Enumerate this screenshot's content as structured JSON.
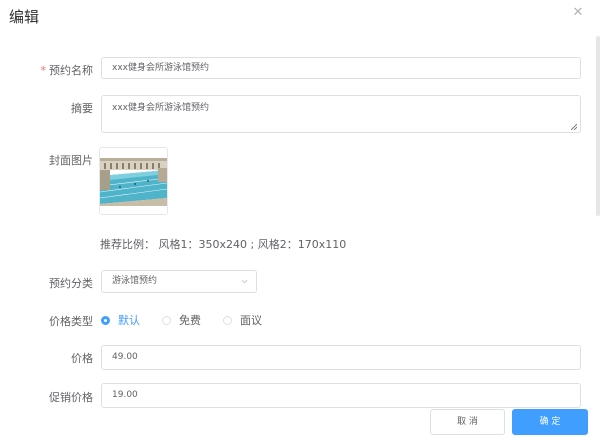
{
  "dialog": {
    "title": "编辑",
    "close_icon": "close-icon"
  },
  "form": {
    "name": {
      "required_mark": "*",
      "label": "预约名称",
      "value": "xxx健身会所游泳馆预约"
    },
    "summary": {
      "label": "摘要",
      "value": "xxx健身会所游泳馆预约"
    },
    "cover": {
      "label": "封面图片",
      "hint": "推荐比例： 风格1：350x240 ; 风格2：170x110"
    },
    "category": {
      "label": "预约分类",
      "value": "游泳馆预约"
    },
    "price_type": {
      "label": "价格类型",
      "options": [
        "默认",
        "免费",
        "面议"
      ],
      "selected": "默认"
    },
    "price": {
      "label": "价格",
      "value": "49.00"
    },
    "promo_price": {
      "label": "促销价格",
      "value": "19.00"
    }
  },
  "footer": {
    "cancel_label": "取 消",
    "confirm_label": "确 定"
  },
  "colors": {
    "primary": "#409eff",
    "required": "#f56c6c",
    "border": "#dcdfe6"
  }
}
